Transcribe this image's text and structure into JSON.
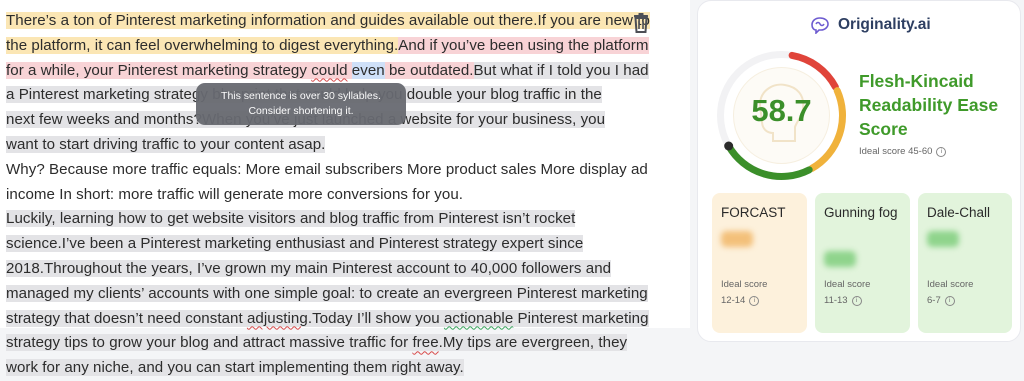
{
  "editor": {
    "lines": [
      {
        "segments": [
          {
            "text": "There’s a ton of Pinterest marketing information and guides available out there.",
            "cls": "hl-y"
          },
          {
            "text": "If you are new to",
            "cls": "hl-y"
          }
        ]
      },
      {
        "segments": [
          {
            "text": "the platform, it can feel overwhelming to digest everything.",
            "cls": "hl-y"
          },
          {
            "text": "And if you’ve been using the platform",
            "cls": "hl-p"
          }
        ]
      },
      {
        "segments": [
          {
            "text": "for a while, your Pinterest marketing strategy ",
            "cls": "hl-p"
          },
          {
            "text": "could",
            "cls": "hl-p ul-r"
          },
          {
            "text": " ",
            "cls": "hl-p"
          },
          {
            "text": "even",
            "cls": "hl-b"
          },
          {
            "text": " be outdated.",
            "cls": "hl-p"
          },
          {
            "text": "But what if I told you I had",
            "cls": "hl-g"
          }
        ]
      },
      {
        "segments": [
          {
            "text": "a Pinterest marketing strategy blueprint that could help you double your blog traffic in the",
            "cls": "hl-g"
          }
        ]
      },
      {
        "segments": [
          {
            "text": "next few weeks and months?",
            "cls": "hl-g"
          },
          {
            "text": "When you’ve just launched a website for your business, you",
            "cls": "hl-g"
          }
        ]
      },
      {
        "segments": [
          {
            "text": "want to start driving traffic to your content asap.",
            "cls": "hl-g"
          }
        ]
      },
      {
        "segments": [
          {
            "text": " Why? Because more traffic equals: More email subscribers More product sales More display ad",
            "cls": ""
          }
        ]
      },
      {
        "segments": [
          {
            "text": "income In short: more traffic will generate more conversions for you.",
            "cls": ""
          }
        ]
      },
      {
        "segments": [
          {
            "text": "Luckily, learning how to get website visitors and blog traffic from Pinterest isn’t rocket",
            "cls": "hl-g"
          }
        ]
      },
      {
        "segments": [
          {
            "text": "science.",
            "cls": "hl-g"
          },
          {
            "text": "I’ve been a Pinterest marketing enthusiast and Pinterest strategy expert since",
            "cls": "hl-g"
          }
        ]
      },
      {
        "segments": [
          {
            "text": "2018.",
            "cls": "hl-g"
          },
          {
            "text": "Throughout the years, I’ve grown my main Pinterest account to 40,000 followers and",
            "cls": "hl-g"
          }
        ]
      },
      {
        "segments": [
          {
            "text": "managed my clients’ accounts with one simple goal: to create an evergreen Pinterest marketing",
            "cls": "hl-g"
          }
        ]
      },
      {
        "segments": [
          {
            "text": "strategy that doesn’t need constant ",
            "cls": "hl-g"
          },
          {
            "text": "adjusting",
            "cls": "hl-g ul-r"
          },
          {
            "text": ".",
            "cls": "hl-g"
          },
          {
            "text": "Today I’ll show you ",
            "cls": "hl-g"
          },
          {
            "text": "actionable",
            "cls": "hl-g ul-g"
          },
          {
            "text": " Pinterest marketing",
            "cls": "hl-g"
          }
        ]
      },
      {
        "segments": [
          {
            "text": "strategy tips to grow your blog and attract massive traffic for ",
            "cls": "hl-g"
          },
          {
            "text": "free",
            "cls": "hl-g ul-r"
          },
          {
            "text": ".",
            "cls": "hl-g"
          },
          {
            "text": "My tips are evergreen, they",
            "cls": "hl-g"
          }
        ]
      },
      {
        "segments": [
          {
            "text": "work for any niche, and you can start implementing them right away.",
            "cls": "hl-g"
          }
        ]
      }
    ],
    "tooltip": {
      "line1": "This sentence is over 30 syllables.",
      "line2": "Consider shortening it."
    }
  },
  "panel": {
    "brand": "Originality.ai",
    "score": "58.7",
    "metric_title": "Flesh-Kincaid Readability Ease Score",
    "ideal_main": "Ideal score 45-60",
    "gauge_value_fraction": 0.587,
    "colors": {
      "green": "#3b8f2a",
      "amber": "#f0b23b",
      "red": "#e0443a",
      "accent": "#6d5bd0"
    },
    "cards": [
      {
        "title": "FORCAST",
        "ideal_label": "Ideal score",
        "range": "12-14",
        "bg": "#fdf1dc",
        "blur": "#f3c07a"
      },
      {
        "title": "Gunning fog",
        "ideal_label": "Ideal score",
        "range": "11-13",
        "bg": "#e2f4dc",
        "blur": "#8fd48c"
      },
      {
        "title": "Dale-Chall",
        "ideal_label": "Ideal score",
        "range": "6-7",
        "bg": "#e2f4dc",
        "blur": "#8fd48c"
      }
    ]
  }
}
